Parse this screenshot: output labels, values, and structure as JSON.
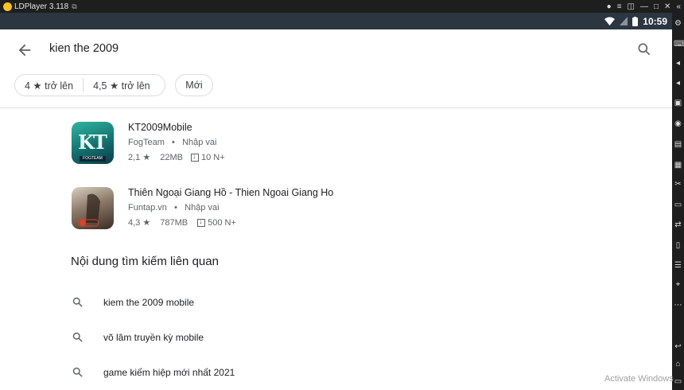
{
  "titlebar": {
    "title": "LDPlayer 3.118",
    "colors": {
      "accent": "#f5c518",
      "bg": "#1e1e1e"
    }
  },
  "status": {
    "time": "10:59",
    "icons": [
      "wifi-icon",
      "signal-icon",
      "battery-icon"
    ]
  },
  "search": {
    "query": "kien the 2009"
  },
  "chips": {
    "rating4": "4 ★ trở lên",
    "rating45": "4,5 ★ trở lên",
    "new": "Mới"
  },
  "results": [
    {
      "title": "KT2009Mobile",
      "developer": "FogTeam",
      "category": "Nhập vai",
      "rating": "2,1 ★",
      "size": "22MB",
      "downloads": "10 N+",
      "icon_label": "FOGTEAM"
    },
    {
      "title": "Thiên Ngoại Giang Hồ - Thien Ngoai Giang Ho",
      "developer": "Funtap.vn",
      "category": "Nhập vai",
      "rating": "4,3 ★",
      "size": "787MB",
      "downloads": "500 N+"
    }
  ],
  "related_section": {
    "title": "Nội dung tìm kiếm liên quan"
  },
  "related": [
    {
      "label": "kiem the 2009 mobile"
    },
    {
      "label": "võ lâm truyền kỳ mobile"
    },
    {
      "label": "game kiếm hiệp mới nhất 2021"
    }
  ],
  "watermark": "Activate Windows"
}
